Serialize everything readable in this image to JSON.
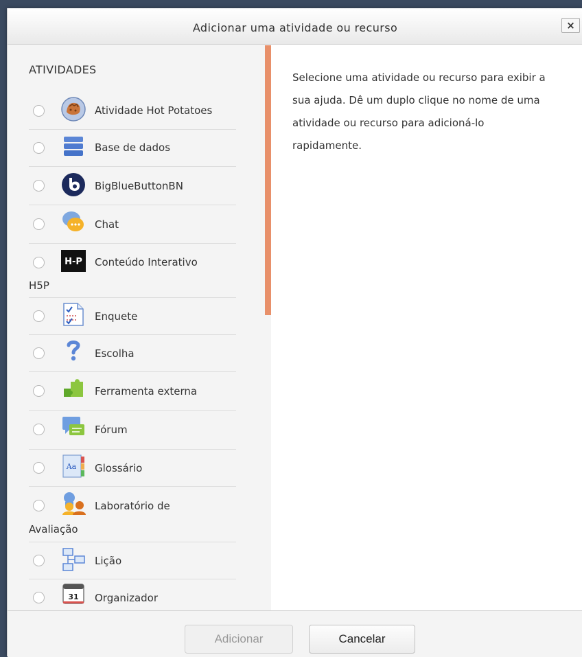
{
  "dialog": {
    "title": "Adicionar uma atividade ou recurso",
    "close_label": "×"
  },
  "options": {
    "section_title": "ATIVIDADES",
    "items": [
      {
        "label": "Atividade Hot Potatoes",
        "icon": "hotpot-icon"
      },
      {
        "label": "Base de dados",
        "icon": "database-icon"
      },
      {
        "label": "BigBlueButtonBN",
        "icon": "bigbluebutton-icon"
      },
      {
        "label": "Chat",
        "icon": "chat-icon"
      },
      {
        "label": "Conteúdo Interativo",
        "label_cont": "H5P",
        "icon": "h5p-icon"
      },
      {
        "label": "Enquete",
        "icon": "survey-icon"
      },
      {
        "label": "Escolha",
        "icon": "question-icon"
      },
      {
        "label": "Ferramenta externa",
        "icon": "puzzle-icon"
      },
      {
        "label": "Fórum",
        "icon": "forum-icon"
      },
      {
        "label": "Glossário",
        "icon": "glossary-icon"
      },
      {
        "label": "Laboratório de",
        "label_cont": "Avaliação",
        "icon": "workshop-icon"
      },
      {
        "label": "Lição",
        "icon": "lesson-icon"
      },
      {
        "label": "Organizador",
        "icon": "calendar-icon",
        "icon_text": "31"
      }
    ]
  },
  "help": {
    "text": "Selecione uma atividade ou recurso para exibir a sua ajuda. Dê um duplo clique no nome de uma atividade ou recurso para adicioná-lo rapidamente."
  },
  "footer": {
    "add_label": "Adicionar",
    "cancel_label": "Cancelar"
  },
  "colors": {
    "scrollbar": "#e8906a",
    "bbb_blue": "#1c2a5c",
    "h5p_black": "#111111"
  }
}
